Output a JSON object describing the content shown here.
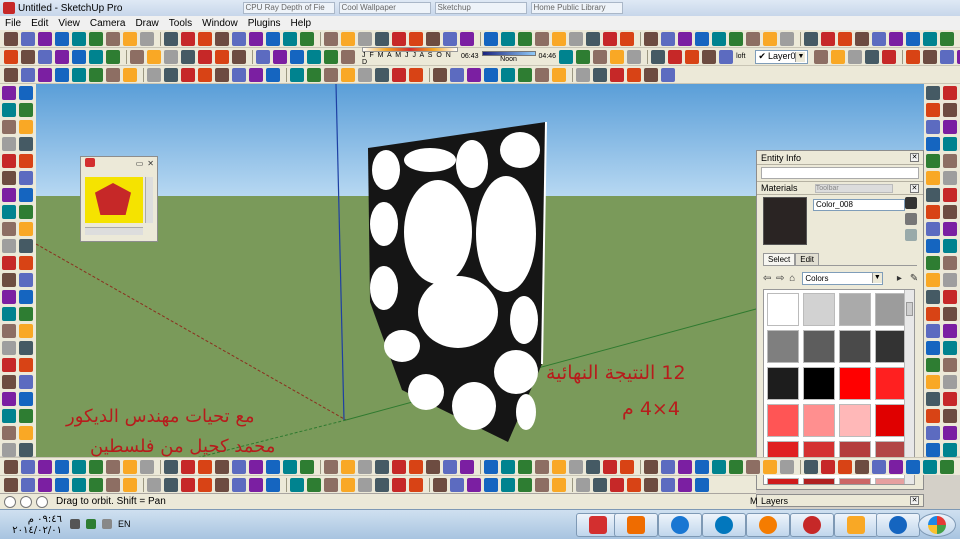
{
  "window": {
    "title": "Untitled - SketchUp Pro",
    "ghost_tabs": [
      "CPU Ray Depth of Fie",
      "Cool Wallpaper",
      "Sketchup",
      "Home Public Library"
    ]
  },
  "menu": [
    "File",
    "Edit",
    "View",
    "Camera",
    "Draw",
    "Tools",
    "Window",
    "Plugins",
    "Help"
  ],
  "shadows": {
    "months": "J F M A M J J A S O N D",
    "time_start": "06:43",
    "noon_label": "Noon",
    "time_end": "04:46"
  },
  "toolbar": {
    "loft_label": "loft",
    "layer_value": "Layer0"
  },
  "viewport": {
    "annotation_line1": "12  النتيجة النهائية",
    "annotation_line2": "4×4 م",
    "credit_line1": "مع تحيات مهندس الديكور",
    "credit_line2": "محمد كحيل من فلسطين"
  },
  "entity_info": {
    "title": "Entity Info"
  },
  "materials": {
    "title": "Materials",
    "ghost_label": "Toolbar",
    "current_name": "Color_008",
    "current_color": "#2a2423",
    "tabs": [
      "Select",
      "Edit"
    ],
    "collection": "Colors",
    "swatches": [
      "#ffffff",
      "#d2d2d2",
      "#aaaaaa",
      "#9c9c9c",
      "#7f7f7f",
      "#5d5d5d",
      "#4a4a4a",
      "#333333",
      "#1d1d1d",
      "#000000",
      "#ff0000",
      "#ff2020",
      "#ff5555",
      "#ff8f8f",
      "#ffb8b8",
      "#e00000",
      "#e02020",
      "#d43232",
      "#b43c3c",
      "#b24646",
      "#cf1a1a",
      "#b02020",
      "#cc6666",
      "#e6a0a0"
    ]
  },
  "layers": {
    "title": "Layers"
  },
  "status": {
    "text": "Drag to orbit.  Shift = Pan",
    "measurements_label": "M"
  },
  "taskbar": {
    "time": "٠٩:٤٦ م",
    "date": "٢٠١٤/٠٢/٠١",
    "language": "EN"
  }
}
